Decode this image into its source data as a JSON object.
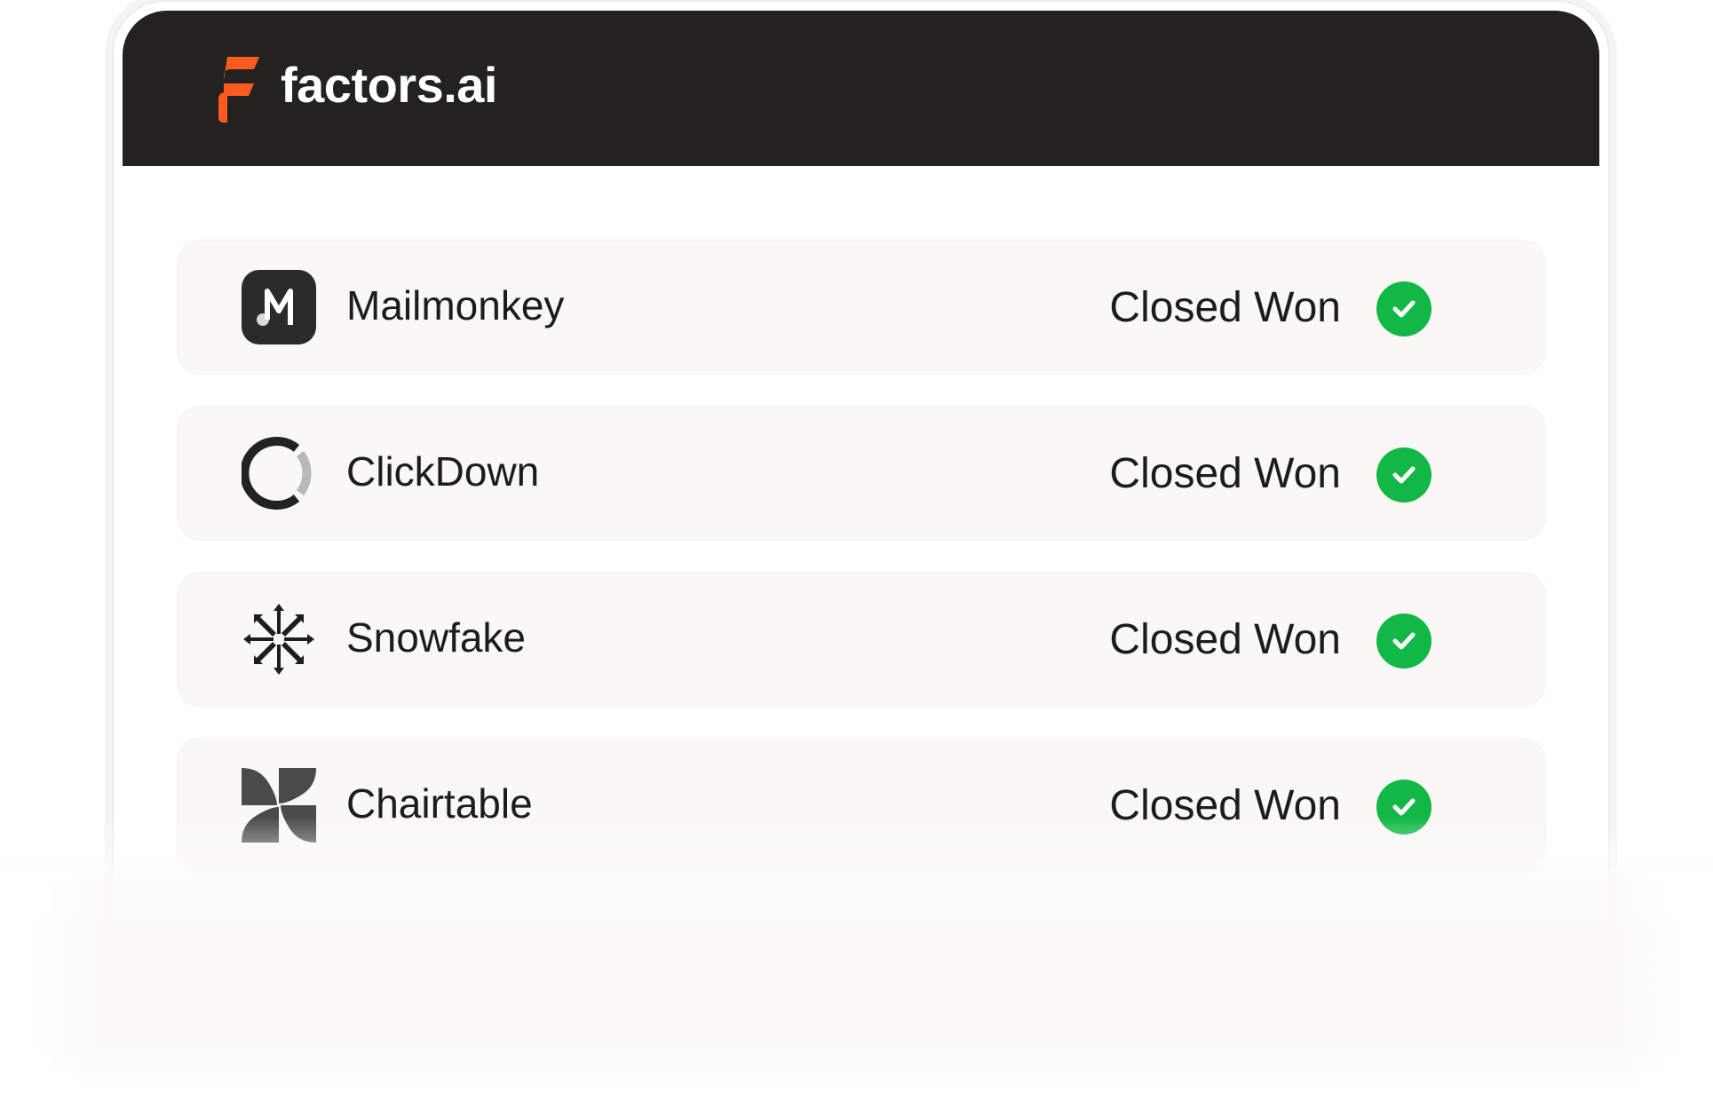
{
  "header": {
    "brand": "factors.ai",
    "brand_color": "#ff5a1f",
    "background": "#232220"
  },
  "deals": [
    {
      "company": "Mailmonkey",
      "logo_icon": "mailmonkey-logo-icon",
      "status": "Closed Won",
      "status_icon": "check-circle-icon"
    },
    {
      "company": "ClickDown",
      "logo_icon": "clickdown-logo-icon",
      "status": "Closed Won",
      "status_icon": "check-circle-icon"
    },
    {
      "company": "Snowfake",
      "logo_icon": "snowfake-logo-icon",
      "status": "Closed Won",
      "status_icon": "check-circle-icon"
    },
    {
      "company": "Chairtable",
      "logo_icon": "chairtable-logo-icon",
      "status": "Closed Won",
      "status_icon": "check-circle-icon"
    }
  ],
  "colors": {
    "success": "#12b845",
    "row_background": "#f9f8f7",
    "text": "#1c1c1c"
  }
}
